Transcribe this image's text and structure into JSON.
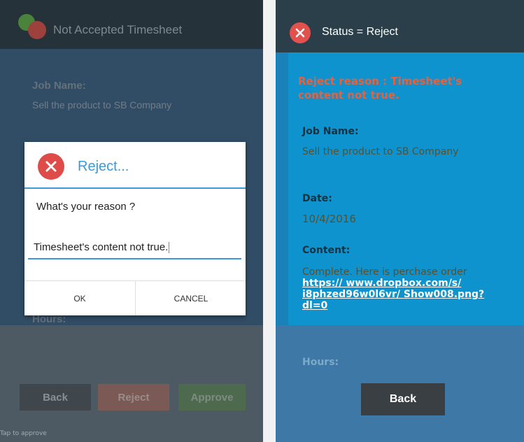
{
  "left_screen": {
    "app_title": "Not Accepted Timesheet",
    "job_name_label": "Job Name:",
    "job_name_value": "Sell the product to SB Company",
    "hours_label": "Hours:",
    "buttons": {
      "back": "Back",
      "reject": "Reject",
      "approve": "Approve"
    },
    "footnote": "Tap to approve"
  },
  "dialog": {
    "title": "Reject...",
    "message": "What's your reason ?",
    "input_value": "Timesheet's content not true.",
    "ok_label": "OK",
    "cancel_label": "CANCEL"
  },
  "right_screen": {
    "title": "Status = Reject",
    "reject_reason": "Reject reason : Timesheet's content not true.",
    "job_name_label": "Job Name:",
    "job_name_value": "Sell the product to SB Company",
    "date_label": "Date:",
    "date_value": "10/4/2016",
    "content_label": "Content:",
    "content_text": "Complete. Here is perchase order",
    "content_link": "https:// www.dropbox.com/s/ i8phzed96w0l6vr/ Show008.png?dl=0",
    "hours_label": "Hours:",
    "back_label": "Back"
  },
  "colors": {
    "accent_blue": "#3b9ad6",
    "reject_red": "#de4b48",
    "right_bg": "#0f93cf",
    "reason_orange": "#e5623c"
  },
  "icons": [
    "app-logo-icon",
    "reject-x-icon",
    "status-x-icon"
  ]
}
